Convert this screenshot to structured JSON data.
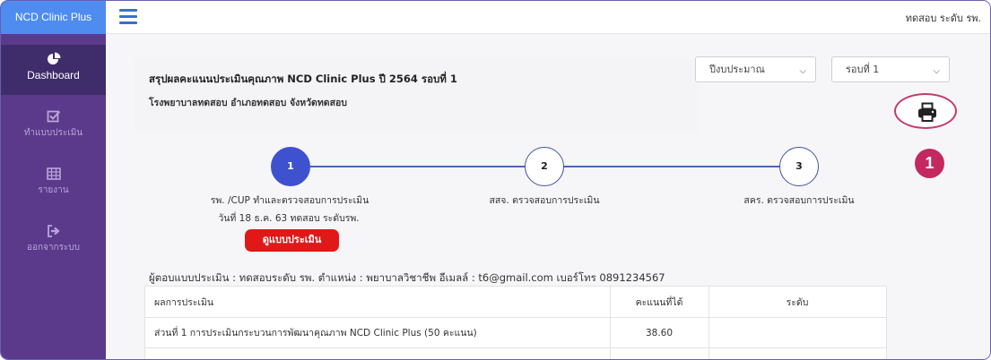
{
  "app": {
    "brand": "NCD Clinic Plus",
    "user": "ทดสอบ ระดับ รพ."
  },
  "sidebar": {
    "items": [
      {
        "label": "Dashboard",
        "icon": "pie-chart-icon",
        "active": true
      },
      {
        "label": "ทำแบบประเมิน",
        "icon": "checkbox-edit-icon",
        "active": false
      },
      {
        "label": "รายงาน",
        "icon": "table-icon",
        "active": false
      },
      {
        "label": "ออกจากระบบ",
        "icon": "sign-out-icon",
        "active": false
      }
    ]
  },
  "header": {
    "title": "สรุปผลคะแนนประเมินคุณภาพ NCD Clinic Plus ปี 2564 รอบที่ 1",
    "subtitle": "โรงพยาบาลทดสอบ อำเภอทดสอบ จังหวัดทดสอบ"
  },
  "filters": {
    "year": {
      "value": "ปีงบประมาณ"
    },
    "round": {
      "value": "รอบที่ 1"
    }
  },
  "print": {
    "icon": "printer-icon",
    "badge": "1"
  },
  "steps": [
    {
      "number": "1",
      "caption": "รพ. /CUP ทำและตรวจสอบการประเมิน",
      "done": true
    },
    {
      "number": "2",
      "caption": "สสจ. ตรวจสอบการประเมิน",
      "done": false
    },
    {
      "number": "3",
      "caption": "สคร. ตรวจสอบการประเมิน",
      "done": false
    }
  ],
  "step1_date": "วันที่ 18 ธ.ค. 63 ทดสอบ ระดับรพ.",
  "view_button": "ดูแบบประเมิน",
  "respondent": "ผู้ตอบแบบประเมิน : ทดสอบระดับ รพ.  ตำแหน่ง : พยาบาลวิชาชีพ  อีเมลล์ : t6@gmail.com เบอร์โทร 0891234567",
  "table": {
    "headers": [
      "ผลการประเมิน",
      "คะแนนที่ได้",
      "ระดับ"
    ],
    "rows": [
      {
        "item": "ส่วนที่ 1 การประเมินกระบวนการพัฒนาคุณภาพ NCD Clinic Plus (50 คะแนน)",
        "score": "38.60",
        "level": ""
      }
    ]
  },
  "colors": {
    "sidebar": "#5b3a8c",
    "brand": "#4e8cf0",
    "step_done": "#3e52d0",
    "button": "#e01818",
    "badge": "#c4285f"
  }
}
